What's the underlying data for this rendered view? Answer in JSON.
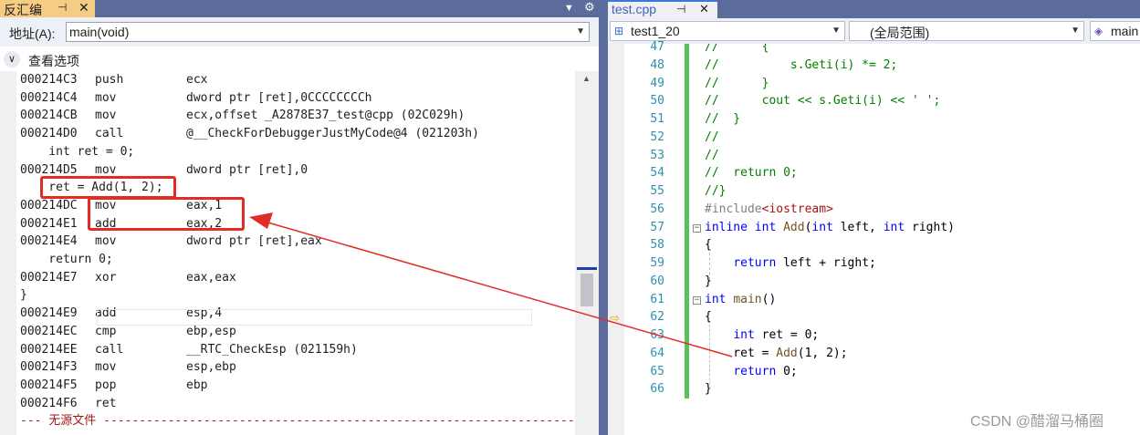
{
  "left_panel": {
    "tab_title": "反汇编",
    "pin_glyph": "⊣",
    "close_glyph": "✕",
    "dropdown_glyph": "▼",
    "gear_glyph": "⚙",
    "address_label": "地址(A):",
    "address_value": "main(void)",
    "view_options_label": "查看选项",
    "lines": [
      {
        "addr": "000214C3",
        "mnemonic": "push",
        "operands": "ecx"
      },
      {
        "addr": "000214C4",
        "mnemonic": "mov",
        "operands": "dword ptr [ret],0CCCCCCCCh"
      },
      {
        "addr": "000214CB",
        "mnemonic": "mov",
        "operands": "ecx,offset _A2878E37_test@cpp (02C029h)"
      },
      {
        "addr": "000214D0",
        "mnemonic": "call",
        "operands": "@__CheckForDebuggerJustMyCode@4 (021203h)"
      },
      {
        "source": "    int ret = 0;"
      },
      {
        "addr": "000214D5",
        "mnemonic": "mov",
        "operands": "dword ptr [ret],0"
      },
      {
        "source": "    ret = Add(1, 2);"
      },
      {
        "addr": "000214DC",
        "mnemonic": "mov",
        "operands": "eax,1"
      },
      {
        "addr": "000214E1",
        "mnemonic": "add",
        "operands": "eax,2"
      },
      {
        "addr": "000214E4",
        "mnemonic": "mov",
        "operands": "dword ptr [ret],eax"
      },
      {
        "source": "    return 0;"
      },
      {
        "addr": "000214E7",
        "mnemonic": "xor",
        "operands": "eax,eax"
      },
      {
        "source": "}"
      },
      {
        "addr": "000214E9",
        "mnemonic": "add",
        "operands": "esp,4"
      },
      {
        "addr": "000214EC",
        "mnemonic": "cmp",
        "operands": "ebp,esp"
      },
      {
        "addr": "000214EE",
        "mnemonic": "call",
        "operands": "__RTC_CheckEsp (021159h)"
      },
      {
        "addr": "000214F3",
        "mnemonic": "mov",
        "operands": "esp,ebp"
      },
      {
        "addr": "000214F5",
        "mnemonic": "pop",
        "operands": "ebp"
      },
      {
        "addr": "000214F6",
        "mnemonic": "ret",
        "operands": ""
      },
      {
        "nosource": "--- 无源文件 -----------------------------------------------------------------------"
      }
    ]
  },
  "right_panel": {
    "tab_title": "test.cpp",
    "pin_glyph": "⊣",
    "close_glyph": "✕",
    "project_combo": "test1_20",
    "scope_combo": "(全局范围)",
    "member_combo": "main",
    "code_lines": [
      {
        "num": "47",
        "text": "//      {",
        "type": "comment"
      },
      {
        "num": "48",
        "text": "//          s.Geti(i) *= 2;",
        "type": "comment"
      },
      {
        "num": "49",
        "text": "//      }",
        "type": "comment"
      },
      {
        "num": "50",
        "text": "//      cout << s.Geti(i) << ' ';",
        "type": "comment"
      },
      {
        "num": "51",
        "text": "//  }",
        "type": "comment"
      },
      {
        "num": "52",
        "text": "//",
        "type": "comment"
      },
      {
        "num": "53",
        "text": "//",
        "type": "comment"
      },
      {
        "num": "54",
        "text": "//  return 0;",
        "type": "comment"
      },
      {
        "num": "55",
        "text": "//}",
        "type": "comment"
      },
      {
        "num": "56",
        "text": "#include<iostream>",
        "type": "include"
      },
      {
        "num": "57",
        "text": "inline int Add(int left, int right)",
        "type": "sig_add"
      },
      {
        "num": "58",
        "text": "{",
        "type": "plain"
      },
      {
        "num": "59",
        "text": "    return left + right;",
        "type": "ret_add"
      },
      {
        "num": "60",
        "text": "}",
        "type": "plain"
      },
      {
        "num": "61",
        "text": "int main()",
        "type": "sig_main"
      },
      {
        "num": "62",
        "text": "{",
        "type": "plain"
      },
      {
        "num": "63",
        "text": "    int ret = 0;",
        "type": "decl"
      },
      {
        "num": "64",
        "text": "    ret = Add(1, 2);",
        "type": "call"
      },
      {
        "num": "65",
        "text": "    return 0;",
        "type": "ret0"
      },
      {
        "num": "66",
        "text": "}",
        "type": "plain"
      }
    ]
  },
  "watermark": "CSDN @醋溜马桶圈",
  "colors": {
    "annotation_red": "#e22b25",
    "tab_active_left": "#f5cc84",
    "tab_bar": "#5a6b9c",
    "change_bar": "#57c25b",
    "keyword": "#0000ff",
    "comment": "#008000"
  }
}
